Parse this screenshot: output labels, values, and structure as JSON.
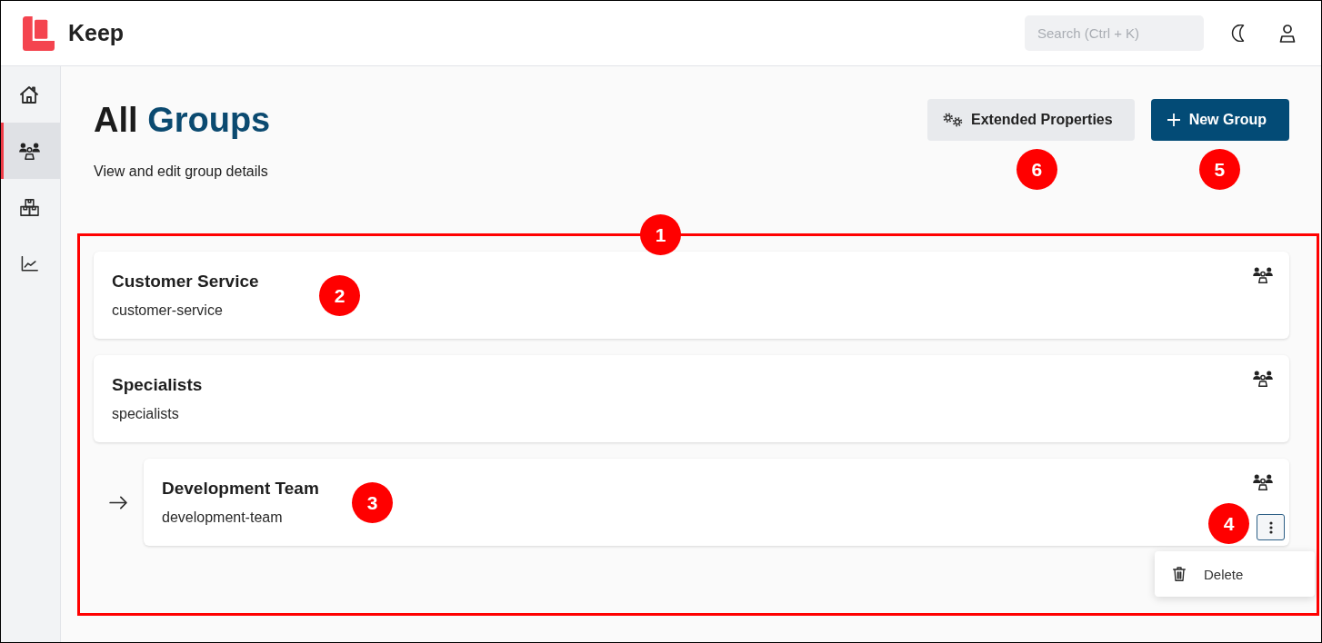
{
  "header": {
    "app_name": "Keep",
    "search": {
      "placeholder": "Search (Ctrl + K)"
    }
  },
  "sidebar": {
    "items": [
      {
        "kind": "home",
        "selected": false
      },
      {
        "kind": "groups",
        "selected": true
      },
      {
        "kind": "boxes",
        "selected": false
      },
      {
        "kind": "chart",
        "selected": false
      }
    ]
  },
  "page": {
    "title_words": [
      {
        "text": "All",
        "accent": false
      },
      {
        "text": "Groups",
        "accent": true
      }
    ],
    "subtitle": "View and edit group details",
    "actions": [
      {
        "kind": "secondary",
        "label": "Extended Properties",
        "callout": "6"
      },
      {
        "kind": "primary",
        "label": "New Group",
        "callout": "5"
      }
    ]
  },
  "groups_panel": {
    "highlighted": true,
    "callout": "1",
    "groups": [
      {
        "name": "Customer Service",
        "slug": "customer-service",
        "callout": "2",
        "menu_open": false
      },
      {
        "name": "Specialists",
        "slug": "specialists",
        "menu_open": false,
        "children": [
          {
            "name": "Development Team",
            "slug": "development-team",
            "callout": "3",
            "menu_open": true,
            "menu_callout": "4",
            "menu": [
              {
                "kind": "delete",
                "label": "Delete"
              }
            ]
          }
        ]
      }
    ]
  }
}
